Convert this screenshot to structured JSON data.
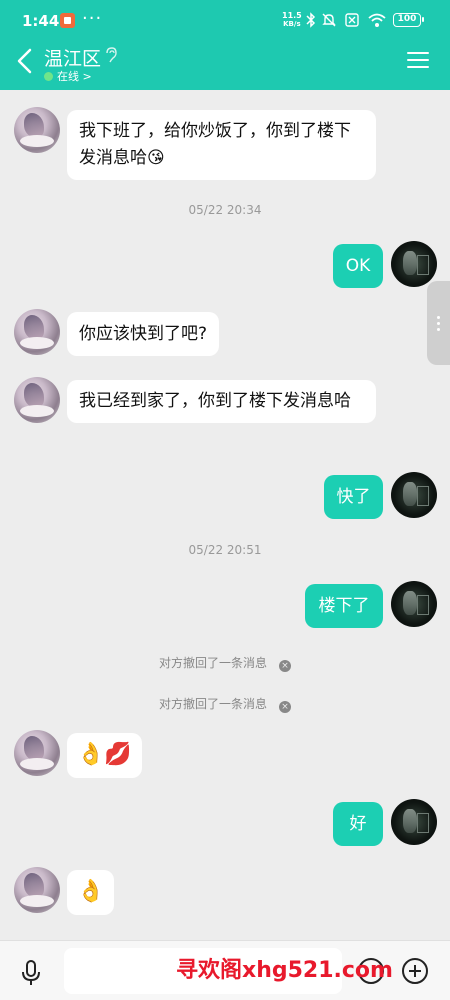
{
  "status_bar": {
    "time": "1:44",
    "dots": "···",
    "net_speed_value": "11.5",
    "net_speed_unit": "KB/s",
    "battery": "100"
  },
  "header": {
    "title": "温江区",
    "presence": "在线",
    "presence_arrow": ">"
  },
  "messages": [
    {
      "side": "left",
      "text": "我下班了，给你炒饭了，你到了楼下发消息哈😘"
    },
    {
      "type": "timestamp",
      "text": "05/22 20:34"
    },
    {
      "side": "right",
      "text": "OK"
    },
    {
      "side": "left",
      "text": "你应该快到了吧?"
    },
    {
      "side": "left",
      "text": "我已经到家了，你到了楼下发消息哈"
    },
    {
      "side": "right",
      "text": "快了"
    },
    {
      "type": "timestamp",
      "text": "05/22 20:51"
    },
    {
      "side": "right",
      "text": "楼下了"
    },
    {
      "type": "recall",
      "text": "对方撤回了一条消息"
    },
    {
      "type": "recall",
      "text": "对方撤回了一条消息"
    },
    {
      "side": "left",
      "text": "👌💋"
    },
    {
      "side": "right",
      "text": "好"
    },
    {
      "side": "left",
      "text": "👌"
    }
  ],
  "recall_close": "×",
  "composer": {
    "placeholder": ""
  },
  "watermark": "寻欢阁xhg521.com",
  "colors": {
    "accent": "#1ec9b0",
    "bubble_right": "#1ccfb3",
    "background": "#ededed"
  }
}
